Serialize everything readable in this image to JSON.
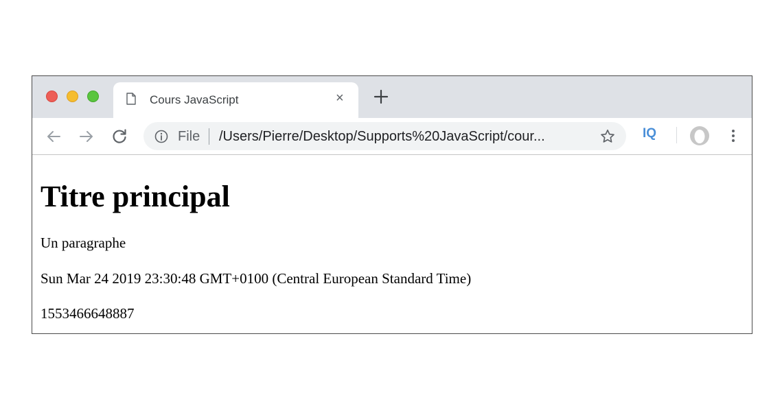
{
  "browser": {
    "tab": {
      "title": "Cours JavaScript",
      "close_label": "×"
    },
    "toolbar": {
      "scheme_label": "File",
      "url": "/Users/Pierre/Desktop/Supports%20JavaScript/cour...",
      "extension_label": "IQ"
    },
    "icons": {
      "back": "back-arrow-icon",
      "forward": "forward-arrow-icon",
      "reload": "reload-icon",
      "info": "info-icon",
      "bookmark": "star-icon",
      "profile": "avatar-icon",
      "menu": "kebab-menu-icon",
      "new_tab": "plus-icon",
      "page": "page-icon"
    },
    "colors": {
      "close": "#ed5e57",
      "minimize": "#f5bd2f",
      "maximize": "#5ac53f",
      "tabstrip": "#dee1e6",
      "extension": "#4a8fd8"
    }
  },
  "page": {
    "heading": "Titre principal",
    "paragraph": "Un paragraphe",
    "date_string": "Sun Mar 24 2019 23:30:48 GMT+0100 (Central European Standard Time)",
    "timestamp": "1553466648887"
  }
}
